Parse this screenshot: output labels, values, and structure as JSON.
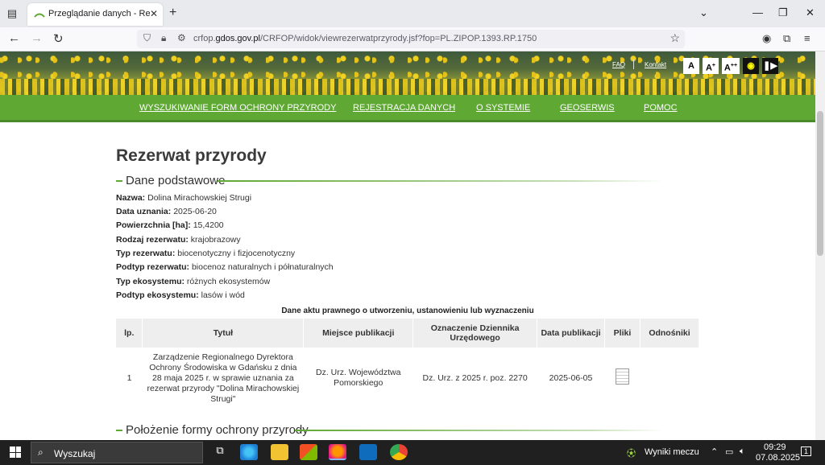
{
  "browser": {
    "tab_title": "Przeglądanie danych - Rezerwat",
    "url_prefix": "crfop.",
    "url_domain": "gdos.gov.pl",
    "url_path": "/CRFOP/widok/viewrezerwatprzyrody.jsf?fop=PL.ZIPOP.1393.RP.1750"
  },
  "banner": {
    "faq": "FAQ",
    "contact": "Kontakt",
    "font_normal": "A",
    "font_larger": "A",
    "font_largest": "A"
  },
  "menu": [
    "WYSZUKIWANIE FORM OCHRONY PRZYRODY",
    "REJESTRACJA DANYCH",
    "O SYSTEMIE",
    "GEOSERWIS",
    "POMOC"
  ],
  "page": {
    "title": "Rezerwat przyrody",
    "section_basic": "Dane podstawowe",
    "section_location": "Położenie formy ochrony przyrody"
  },
  "fields": [
    {
      "label": "Nazwa:",
      "value": "Dolina Mirachowskiej Strugi"
    },
    {
      "label": "Data uznania:",
      "value": "2025-06-20"
    },
    {
      "label": "Powierzchnia [ha]:",
      "value": "15,4200"
    },
    {
      "label": "Rodzaj rezerwatu:",
      "value": "krajobrazowy"
    },
    {
      "label": "Typ rezerwatu:",
      "value": "biocenotyczny i fizjocenotyczny"
    },
    {
      "label": "Podtyp rezerwatu:",
      "value": "biocenoz naturalnych i półnaturalnych"
    },
    {
      "label": "Typ ekosystemu:",
      "value": "różnych ekosystemów"
    },
    {
      "label": "Podtyp ekosystemu:",
      "value": "lasów i wód"
    }
  ],
  "acts_table": {
    "caption": "Dane aktu prawnego o utworzeniu, ustanowieniu lub wyznaczeniu",
    "headers": [
      "lp.",
      "Tytuł",
      "Miejsce publikacji",
      "Oznaczenie Dziennika Urzędowego",
      "Data publikacji",
      "Pliki",
      "Odnośniki"
    ],
    "rows": [
      {
        "lp": "1",
        "title": "Zarządzenie Regionalnego Dyrektora Ochrony Środowiska w Gdańsku z dnia 28 maja 2025 r. w sprawie uznania za rezerwat przyrody \"Dolina Mirachowskiej Strugi\"",
        "place": "Dz. Urz. Województwa Pomorskiego",
        "journal": "Dz. Urz. z 2025 r. poz. 2270",
        "date": "2025-06-05",
        "links": ""
      }
    ]
  },
  "taskbar": {
    "search_placeholder": "Wyszukaj",
    "widget_text": "Wyniki meczu",
    "time": "09:29",
    "date": "07.08.2025",
    "notifications": "1"
  }
}
